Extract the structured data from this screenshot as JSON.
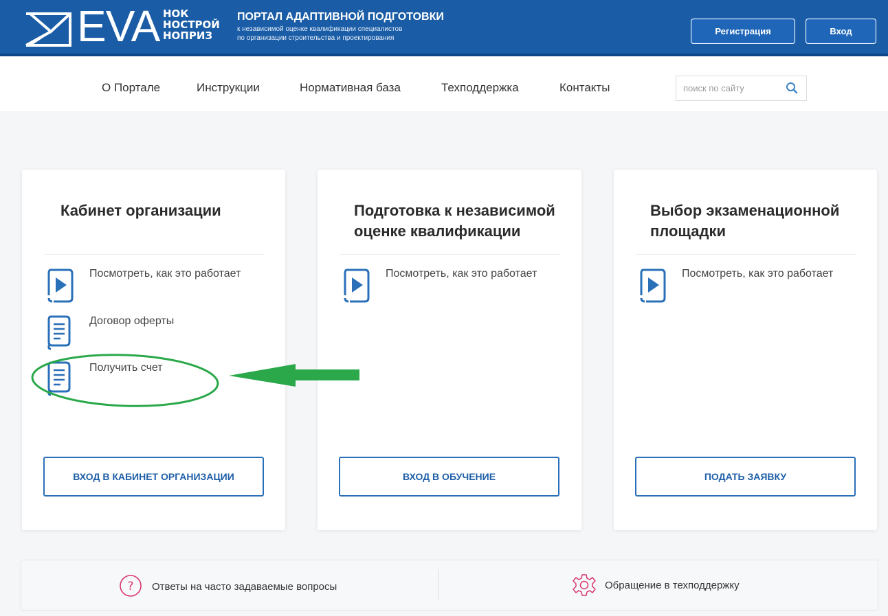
{
  "header": {
    "logo_text": "EVA",
    "logo_sub": [
      "НОК",
      "НОСТРОЙ",
      "НОПРИЗ"
    ],
    "portal_title": "ПОРТАЛ АДАПТИВНОЙ ПОДГОТОВКИ",
    "portal_sub": [
      "к независимой оценке квалификации специалистов",
      "по организации строительства и проектирования"
    ],
    "register_label": "Регистрация",
    "login_label": "Вход"
  },
  "nav": {
    "items": [
      "О Портале",
      "Инструкции",
      "Нормативная база",
      "Техподдержка",
      "Контакты"
    ],
    "search_placeholder": "поиск по сайту"
  },
  "cards": [
    {
      "title": [
        "Кабинет организации"
      ],
      "items": [
        {
          "icon": "play-icon",
          "label": "Посмотреть, как это работает"
        },
        {
          "icon": "document-icon",
          "label": "Договор оферты"
        },
        {
          "icon": "document-icon",
          "label": "Получить счет"
        }
      ],
      "button": "ВХОД В КАБИНЕТ ОРГАНИЗАЦИИ"
    },
    {
      "title": [
        "Подготовка к независимой",
        "оценке квалификации"
      ],
      "items": [
        {
          "icon": "play-icon",
          "label": "Посмотреть, как это работает"
        }
      ],
      "button": "ВХОД В ОБУЧЕНИЕ"
    },
    {
      "title": [
        "Выбор экзаменационной",
        "площадки"
      ],
      "items": [
        {
          "icon": "play-icon",
          "label": "Посмотреть, как это работает"
        }
      ],
      "button": "ПОДАТЬ ЗАЯВКУ"
    }
  ],
  "footer": {
    "faq_label": "Ответы на часто задаваемые вопросы",
    "support_label": "Обращение в техподдержку"
  },
  "colors": {
    "header_blue": "#1a5da6",
    "accent_blue": "#2a70b9",
    "annotation_green": "#2aa84a",
    "faq_icon": "#d9366b"
  }
}
